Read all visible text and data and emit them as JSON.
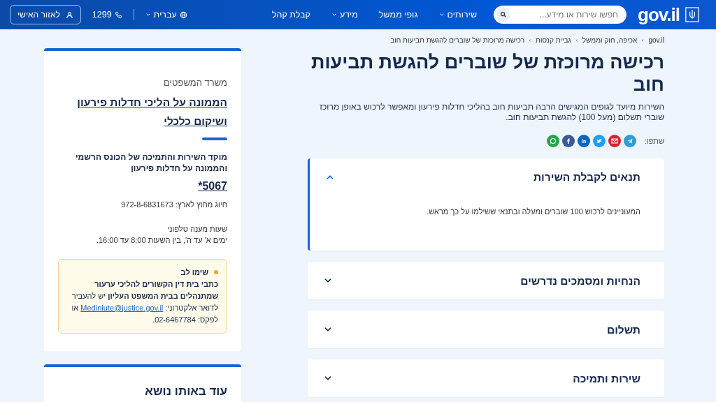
{
  "header": {
    "logo_text": "gov.il",
    "search": {
      "placeholder": "חפשו שירות או מידע..."
    },
    "nav": [
      {
        "label": "שירותים",
        "dropdown": true
      },
      {
        "label": "גופי ממשל",
        "dropdown": false
      },
      {
        "label": "מידע",
        "dropdown": true
      },
      {
        "label": "קבלת קהל",
        "dropdown": false
      }
    ],
    "language": "עברית",
    "phone": "1299",
    "personal_button": "לאזור האישי"
  },
  "breadcrumbs": [
    "gov.il",
    "אכיפה, חוק וממשל",
    "גביית קנסות",
    "רכישה מרוכזת של שוברים להגשת תביעות חוב"
  ],
  "title": "רכישה מרוכזת של שוברים להגשת תביעות חוב",
  "description": "השירות מיועד לגופים המגישים הרבה תביעות חוב בהליכי חדלות פירעון ומאפשר לרכוש באופן מרוכז שוברי תשלום (מעל 100) להגשת תביעות חוב.",
  "share": {
    "label": "שתפו:",
    "buttons": [
      {
        "kind": "telegram"
      },
      {
        "kind": "email"
      },
      {
        "kind": "twitter"
      },
      {
        "kind": "linkedin"
      },
      {
        "kind": "facebook"
      },
      {
        "kind": "whatsapp"
      }
    ]
  },
  "accordion": [
    {
      "title": "תנאים לקבלת השירות",
      "expanded": true,
      "body": "המעוניינים לרכוש 100 שוברים ומעלה ובתנאי ששילמו על כך מראש."
    },
    {
      "title": "הנחיות ומסמכים נדרשים",
      "expanded": false
    },
    {
      "title": "תשלום",
      "expanded": false
    },
    {
      "title": "שירות ותמיכה",
      "expanded": false
    }
  ],
  "sidebar": {
    "ministry": "משרד המשפטים",
    "unit_link": "הממונה על הליכי חדלות פירעון ושיקום כלכלי",
    "service_center": "מוקד השירות והתמיכה של הכונס הרשמי והממונה על חדלות פירעון",
    "service_phone": "*5067",
    "abroad": "חיוג מחוץ לארץ: 972-8-6831673",
    "hours_title": "שעות מענה טלפוני",
    "hours": "ימים א' עד ה', בין השעות 8:00 עד 16:00.",
    "notice": {
      "title": "שימו לב",
      "text_before": "**כתבי בית דין הקשורים להליכי ערעור שמתנהלים בבית המשפט העליון** יש להעביר לדואר אלקטרוני:",
      "email": "Mediniute@justice.gov.il",
      "text_after": "או לפקס: 02-6467784."
    }
  },
  "related": {
    "title": "עוד באותו נושא"
  }
}
